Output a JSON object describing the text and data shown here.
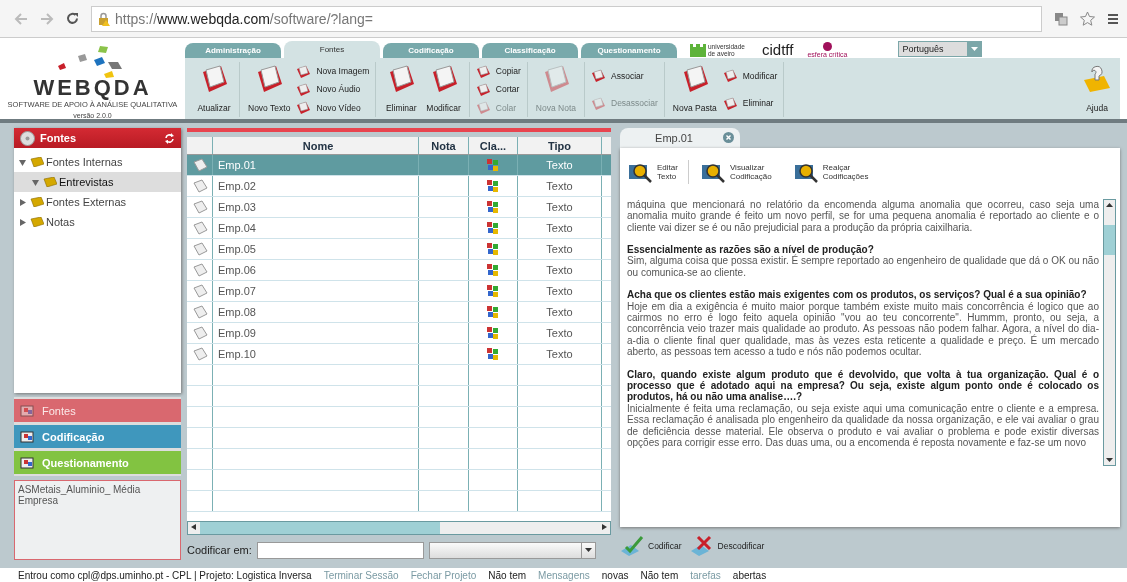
{
  "browser": {
    "url_scheme": "https://",
    "url_host": "www.webqda.com",
    "url_path": "/software/?lang="
  },
  "header": {
    "logo": {
      "name": "WEBQDA",
      "tagline": "SOFTWARE DE APOIO À ANÁLISE QUALITATIVA",
      "version": "versão 2.0.0"
    },
    "tabs": [
      {
        "label": "Administração",
        "selected": false
      },
      {
        "label": "Fontes",
        "selected": true
      },
      {
        "label": "Codificação",
        "selected": false
      },
      {
        "label": "Classificação",
        "selected": false
      },
      {
        "label": "Questionamento",
        "selected": false
      }
    ],
    "partners": [
      {
        "label": "universidade de aveiro"
      },
      {
        "label": "cidtff"
      },
      {
        "label": "esfera crítica"
      }
    ],
    "language": "Português"
  },
  "toolbar": {
    "groups": [
      {
        "items": [
          {
            "label": "Atualizar",
            "kind": "large",
            "disabled": false
          }
        ]
      },
      {
        "items": [
          {
            "label": "Novo Texto",
            "kind": "large",
            "disabled": false
          },
          {
            "label": "Nova Imagem",
            "kind": "small",
            "disabled": false
          },
          {
            "label": "Novo Áudio",
            "kind": "small",
            "disabled": false
          },
          {
            "label": "Novo Vídeo",
            "kind": "small",
            "disabled": false
          }
        ]
      },
      {
        "items": [
          {
            "label": "Eliminar",
            "kind": "large",
            "disabled": false
          },
          {
            "label": "Modificar",
            "kind": "large",
            "disabled": false
          }
        ]
      },
      {
        "items": [
          {
            "label": "Copiar",
            "kind": "small",
            "disabled": false
          },
          {
            "label": "Cortar",
            "kind": "small",
            "disabled": false
          },
          {
            "label": "Colar",
            "kind": "small",
            "disabled": true
          }
        ]
      },
      {
        "items": [
          {
            "label": "Nova Nota",
            "kind": "large",
            "disabled": true
          }
        ]
      },
      {
        "items": [
          {
            "label": "Associar",
            "kind": "small",
            "disabled": false
          },
          {
            "label": "Desassociar",
            "kind": "small",
            "disabled": true
          }
        ]
      },
      {
        "items": [
          {
            "label": "Nova Pasta",
            "kind": "large",
            "disabled": false
          },
          {
            "label": "Modificar",
            "kind": "small",
            "disabled": false
          },
          {
            "label": "Eliminar",
            "kind": "small",
            "disabled": false
          }
        ]
      }
    ],
    "help": "Ajuda"
  },
  "sidebar": {
    "title": "Fontes",
    "tree": [
      {
        "label": "Fontes Internas",
        "expanded": true,
        "selected": false,
        "children": [
          {
            "label": "Entrevistas",
            "expanded": true,
            "selected": true
          }
        ]
      },
      {
        "label": "Fontes Externas",
        "expanded": false,
        "selected": false
      },
      {
        "label": "Notas",
        "expanded": false,
        "selected": false
      }
    ],
    "sections": [
      {
        "label": "Fontes",
        "color": "#d9686f",
        "disabled": true
      },
      {
        "label": "Codificação",
        "color": "#3f97bd",
        "disabled": false
      },
      {
        "label": "Questionamento",
        "color": "#82c341",
        "disabled": false
      }
    ],
    "description": "ASMetais_Aluminio_ Média Empresa"
  },
  "table": {
    "columns": [
      "Nome",
      "Nota",
      "Cla...",
      "Tipo"
    ],
    "rows": [
      {
        "nome": "Emp.01",
        "tipo": "Texto",
        "selected": true
      },
      {
        "nome": "Emp.02",
        "tipo": "Texto",
        "selected": false
      },
      {
        "nome": "Emp.03",
        "tipo": "Texto",
        "selected": false
      },
      {
        "nome": "Emp.04",
        "tipo": "Texto",
        "selected": false
      },
      {
        "nome": "Emp.05",
        "tipo": "Texto",
        "selected": false
      },
      {
        "nome": "Emp.06",
        "tipo": "Texto",
        "selected": false
      },
      {
        "nome": "Emp.07",
        "tipo": "Texto",
        "selected": false
      },
      {
        "nome": "Emp.08",
        "tipo": "Texto",
        "selected": false
      },
      {
        "nome": "Emp.09",
        "tipo": "Texto",
        "selected": false
      },
      {
        "nome": "Emp.10",
        "tipo": "Texto",
        "selected": false
      }
    ]
  },
  "coding": {
    "label": "Codificar em:",
    "buttons": [
      "Codificar",
      "Descodificar"
    ]
  },
  "document": {
    "tab": "Emp.01",
    "tools": [
      {
        "line1": "Editar",
        "line2": "Texto"
      },
      {
        "line1": "Visualizar",
        "line2": "Codificação"
      },
      {
        "line1": "Realçar",
        "line2": "Codificações"
      }
    ],
    "paragraphs": [
      {
        "kind": "answer",
        "text": "máquina que mencionará no relatório da encomenda alguma anomalia que ocorreu, caso seja uma anomalia muito grande é feito um novo perfil, se for uma pequena anomalia é reportado ao cliente e o cliente vai dizer se é ou não prejudicial para a produção da própria caixilharia."
      },
      {
        "kind": "question",
        "text": "Essencialmente as razões são a nível de produção?"
      },
      {
        "kind": "answer",
        "text": "Sim, alguma coisa que possa existir. É sempre reportado ao engenheiro de qualidade que dá o OK ou não ou comunica-se ao cliente."
      },
      {
        "kind": "question",
        "text": "Acha que os clientes estão mais exigentes com os produtos, os serviços? Qual é a sua opinião?"
      },
      {
        "kind": "answer",
        "text": "Hoje em dia a exigência é muito maior porque também existe muito mais concorrência é logico que ao cairmos no erro é logo feito aquela opinião \"vou ao teu concorrente\". Hummm, pronto, ou seja, a concorrência veio trazer mais qualidade ao produto. As pessoas não podem falhar. Agora, a nível do dia-a-dia o cliente final quer qualidade, mas às vezes esta reticente a qualidade e preço. É um mercado aberto, as pessoas tem acesso a tudo e nós não podemos ocultar."
      },
      {
        "kind": "question",
        "text": "Claro, quando existe algum produto que é devolvido, que volta à tua organização. Qual é o processo que é adotado aqui na empresa? Ou seja, existe algum ponto onde é colocado os produtos, há ou não uma analise….?"
      },
      {
        "kind": "answer",
        "text": "Inicialmente é feita uma reclamação, ou seja existe aqui uma comunicação entre o cliente e a empresa. Essa reclamação é analisada plo engenheiro da qualidade da nossa organização, e ele vai avaliar o grau de deficiência desse material. Ele observa o produto e vai avaliar o problema e pode existir diversas opções para corrigir esse erro. Das duas uma, ou a encomenda é reposta novamente e faz-se um novo"
      }
    ]
  },
  "status_bar": [
    {
      "kind": "text",
      "text": "Entrou como cpl@dps.uminho.pt - CPL | Projeto: Logistica Inversa"
    },
    {
      "kind": "link",
      "text": "Terminar Sessão"
    },
    {
      "kind": "link",
      "text": "Fechar Projeto"
    },
    {
      "kind": "text",
      "text": "Não tem"
    },
    {
      "kind": "link",
      "text": "Mensagens"
    },
    {
      "kind": "text",
      "text": "novas"
    },
    {
      "kind": "text",
      "text": "Não tem"
    },
    {
      "kind": "link",
      "text": "tarefas"
    },
    {
      "kind": "text",
      "text": "abertas"
    }
  ]
}
